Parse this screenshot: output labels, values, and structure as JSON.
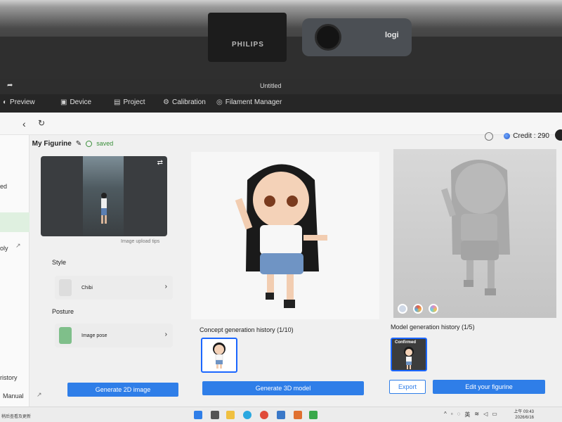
{
  "environment": {
    "monitor_brand": "PHILIPS",
    "webcam_brand": "logi"
  },
  "window": {
    "title": "Untitled"
  },
  "menubar": {
    "items": [
      {
        "label": "Preview",
        "icon": "preview-icon"
      },
      {
        "label": "Device",
        "icon": "device-icon"
      },
      {
        "label": "Project",
        "icon": "project-icon"
      },
      {
        "label": "Calibration",
        "icon": "calibration-icon"
      },
      {
        "label": "Filament Manager",
        "icon": "filament-icon"
      }
    ]
  },
  "account": {
    "credit_label": "Credit : 290"
  },
  "header": {
    "title": "My Figurine",
    "status": "saved"
  },
  "sidebar": {
    "items": [
      "ed",
      "oly",
      "ristory",
      "Manual"
    ]
  },
  "left_panel": {
    "upload_tips": "Image upload tips",
    "style_label": "Style",
    "style_value": "Chibi",
    "posture_label": "Posture",
    "posture_value": "Image pose",
    "generate_2d": "Generate 2D image"
  },
  "center_panel": {
    "history_label": "Concept generation history (1/10)",
    "generate_3d": "Generate 3D model"
  },
  "right_panel": {
    "history_label": "Model generation history (1/5)",
    "thumb_badge": "Confirmed",
    "export": "Export",
    "edit": "Edit your figurine",
    "swatch_colors": [
      "#cfd8e6",
      "#e0a070",
      "#d98ad0"
    ]
  },
  "taskbar": {
    "clock_time": "上午 09:43",
    "clock_date": "2026/6/16",
    "left_text": "稍后查看及更新"
  },
  "colors": {
    "accent": "#2f7ee8",
    "saved_green": "#3a8f3a",
    "menubar_bg": "#262626"
  }
}
